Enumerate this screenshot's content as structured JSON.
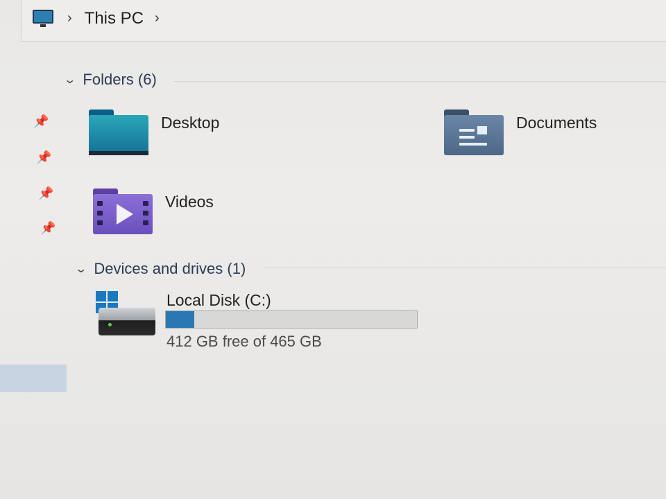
{
  "address_bar": {
    "crumbs": [
      "This PC"
    ]
  },
  "folders_section": {
    "header": "Folders (6)",
    "items": [
      {
        "label": "Desktop",
        "icon": "desktop-folder-icon"
      },
      {
        "label": "Documents",
        "icon": "documents-folder-icon"
      },
      {
        "label": "Videos",
        "icon": "videos-folder-icon"
      }
    ]
  },
  "devices_section": {
    "header": "Devices and drives (1)",
    "drives": [
      {
        "name": "Local Disk (C:)",
        "free_text": "412 GB free of 465 GB",
        "used_fraction": 0.114,
        "icon": "local-disk-icon"
      }
    ]
  },
  "colors": {
    "accent": "#2a78b2",
    "nav_selected": "#c7d4e2"
  }
}
